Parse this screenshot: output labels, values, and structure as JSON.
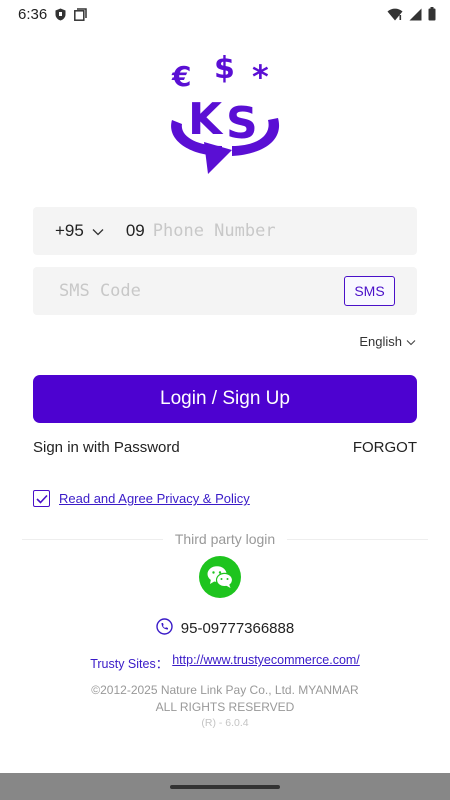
{
  "status_bar": {
    "time": "6:36",
    "left_icons": [
      "shield-icon",
      "clipboard-icon"
    ],
    "right_icons": [
      "wifi-icon",
      "signal-icon",
      "battery-icon"
    ]
  },
  "logo": {
    "name": "KS money logo",
    "color": "#5a0fd4"
  },
  "phone": {
    "country_code": "+95",
    "prefix": "09",
    "placeholder": "Phone Number"
  },
  "sms": {
    "placeholder": "SMS Code",
    "button_label": "SMS"
  },
  "language": {
    "selected": "English"
  },
  "login_button": {
    "label": "Login / Sign Up",
    "color": "#4d02d0"
  },
  "links": {
    "password": "Sign in with Password",
    "forgot": "FORGOT"
  },
  "agreement": {
    "checked": true,
    "label": "Read and Agree Privacy & Policy"
  },
  "third_party": {
    "label": "Third party login",
    "providers": [
      "wechat-icon"
    ]
  },
  "hotline": {
    "number": "95-09777366888"
  },
  "trusty": {
    "label": "Trusty Sites：",
    "url": "http://www.trustyecommerce.com/"
  },
  "footer": {
    "copyright": "©2012-2025 Nature Link Pay Co., Ltd. MYANMAR",
    "rights": "ALL RIGHTS RESERVED",
    "version": "(R) - 6.0.4"
  }
}
